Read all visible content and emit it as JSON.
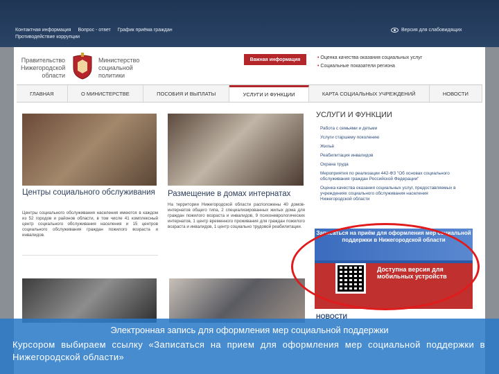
{
  "topbar": {
    "links": [
      "Контактная информация",
      "Вопрос - ответ",
      "График приёма граждан"
    ],
    "link2": "Противодействие коррупции",
    "accessibility": "Версия для слабовидящих"
  },
  "header": {
    "gov_left": "Правительство Нижегородской области",
    "gov_right": "Министерство социальной политики",
    "notice": "Важная информация",
    "top_links": [
      "Оценка качества оказания социальных услуг",
      "Социальные показатели региона"
    ]
  },
  "nav": {
    "tabs": [
      "ГЛАВНАЯ",
      "О МИНИСТЕРСТВЕ",
      "ПОСОБИЯ И ВЫПЛАТЫ",
      "УСЛУГИ И ФУНКЦИИ",
      "КАРТА СОЦИАЛЬНЫХ УЧРЕЖДЕНИЙ",
      "НОВОСТИ"
    ]
  },
  "cards": [
    {
      "title": "Центры социального обслуживания",
      "text": "Центры социального обслуживания населения имеются в каждом из 52 городов и районов области, в том числе 41 комплексный центр социального обслуживания населения и 15 центров социального обслуживания граждан пожилого возраста и инвалидов."
    },
    {
      "title": "Размещение в домах интернатах",
      "text": "На территории Нижегородской области расположены 40 домов-интернатов общего типа, 2 специализированных жилых дома для граждан пожилого возраста и инвалидов, 9 психоневрологических интернатов, 1 центр временного проживания для граждан пожилого возраста и инвалидов, 1 центр социально трудовой реабилитации."
    }
  ],
  "right": {
    "title": "УСЛУГИ И ФУНКЦИИ",
    "items": [
      "Работа с семьями и детьми",
      "Услуги старшему поколению",
      "Жильё",
      "Реабилитация инвалидов",
      "Охрана труда",
      "Мероприятия по реализации 442-ФЗ \"Об основах социального обслуживания граждан Российской Федерации\"",
      "Оценка качества оказания социальных услуг, предоставляемых в учреждениях социального обслуживания населения Нижегородской области"
    ],
    "banner_top": "Записаться на приём для оформления мер социальной поддержки в Нижегородской области",
    "banner_mobile": "Доступна версия для мобильных устройств",
    "news": "НОВОСТИ"
  },
  "caption": {
    "title": "Электронная запись для оформления мер социальной поддержки",
    "body": "Курсором выбираем ссылку «Записаться на прием для оформления мер социальной поддержки в Нижегородской области»"
  },
  "colors": {
    "brand_red": "#b5262b",
    "highlight_red": "#e11b1b",
    "caption_bg": "#2878c8"
  }
}
